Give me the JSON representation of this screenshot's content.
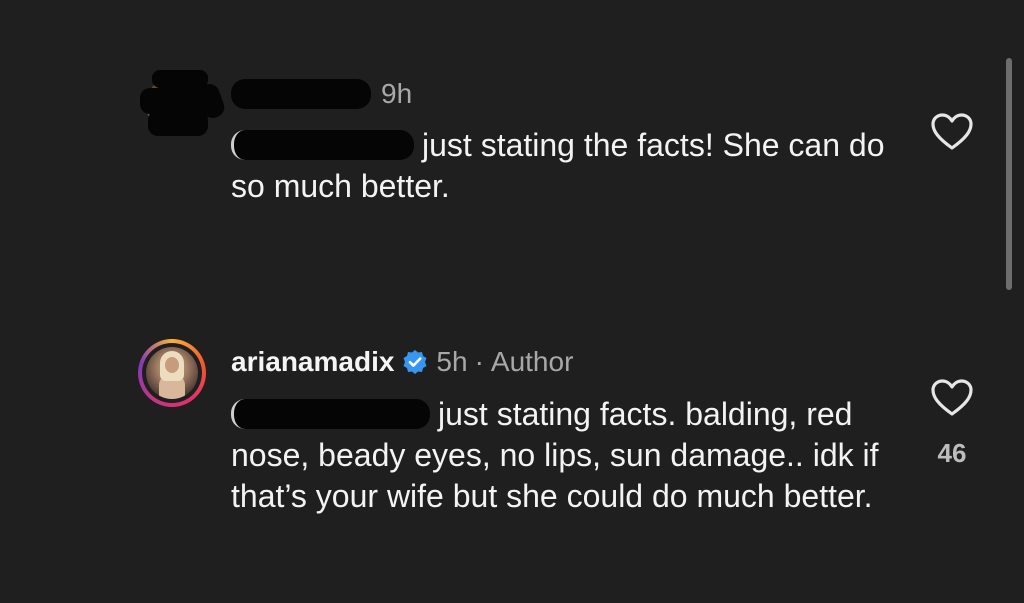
{
  "comments": [
    {
      "username": "",
      "time": "9h",
      "author_tag": "",
      "text": "just stating the facts! She can do so much better.",
      "likes": "",
      "avatar": "redacted-avatar",
      "icon": "heart-outline-icon"
    },
    {
      "username": "arianamadix",
      "time": "5h",
      "separator": "·",
      "author_tag": "Author",
      "text": "just stating facts. balding, red nose, beady eyes, no lips, sun damage.. idk if that’s your wife but she could do much better.",
      "likes": "46",
      "avatar": "profile-photo",
      "icon": "heart-outline-icon"
    }
  ],
  "colors": {
    "background": "#1f1f1f",
    "primary_text": "#f3f3f3",
    "secondary_text": "#a8a8a8",
    "verified_badge": "#3797f0"
  }
}
